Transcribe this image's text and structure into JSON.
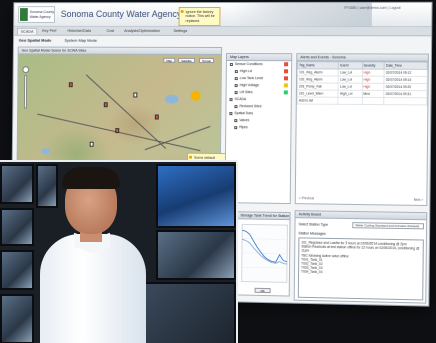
{
  "app": {
    "title": "Sonoma County Water Agency Pilot",
    "logo_text": "Sonoma County Water Agency",
    "user_info": "FF3380 | user@demo.com  | Logout"
  },
  "tabs": [
    "SCADA",
    "Key Perf",
    "Historian/Data",
    "Cost",
    "Analysis/Optimization",
    "Settings"
  ],
  "subtabs": [
    "Geo Spatial Mode",
    "System Map Mode"
  ],
  "notes": {
    "top": "Ignore the factory notice. This will be replaced.",
    "mid": "Some default selection, locations, status."
  },
  "map_panel": {
    "title": "Geo Spatial Model Scene for SCWA Sites",
    "buttons": [
      "Map",
      "Satellite",
      "Terrain"
    ]
  },
  "legend_panel": {
    "title": "Map Layers",
    "items": [
      {
        "label": "Sensor Conditions",
        "swatch": "#e74c3c"
      },
      {
        "label": "High Lvl",
        "swatch": "#e74c3c"
      },
      {
        "label": "Low Tank Level",
        "swatch": "#e74c3c"
      },
      {
        "label": "High Voltage",
        "swatch": "#f1c40f"
      },
      {
        "label": "Lift Sites",
        "swatch": "#2ecc71"
      },
      {
        "label": "SCADA",
        "swatch": ""
      },
      {
        "label": "Reduced Sites",
        "swatch": ""
      },
      {
        "label": "Spatial Data",
        "swatch": ""
      },
      {
        "label": "Valves",
        "swatch": ""
      },
      {
        "label": "Pipes",
        "swatch": ""
      }
    ]
  },
  "alerts_panel": {
    "title": "Alerts and Events - Sonoma",
    "columns": [
      "Tag_Name",
      "Event",
      "Severity",
      "Date_Time"
    ],
    "rows": [
      [
        "101_Reg_Alarm",
        "Low_Lvl",
        "High",
        "02/07/2014 09:12"
      ],
      [
        "102_Reg_Alarm",
        "Low_Lvl",
        "High",
        "02/07/2014 09:14"
      ],
      [
        "203_Pump_Fail",
        "Low_Lvl",
        "High",
        "02/07/2014 09:20"
      ],
      [
        "210_Level_Warn",
        "High_Lvl",
        "Med",
        "02/07/2014 09:31"
      ],
      [
        "Add to list",
        "",
        "",
        ""
      ]
    ],
    "footer_prev": "< Previous",
    "footer_next": "Next >"
  },
  "activity_panel": {
    "title": "Activity Board",
    "select_label": "Select Station Type",
    "select_value": "Water Cycling Standard and Animator (Default)",
    "messages_label": "Station Messages",
    "messages": [
      "101_Regulator and Lowflw for 3 hours at 02/06/2014 conditioning @ 2pm",
      "Station Readouts at test station offline for 12 hours on 02/06/2014, conditioning @ 11pm",
      "TBC following Active valve offline",
      "T001_Tank_01",
      "T002_Tank_02",
      "T003_Tank_03",
      "T004_Tank_04"
    ]
  },
  "chart_panel": {
    "title": "Storage Tank Trend for Station",
    "button": "OK"
  },
  "chart_data": {
    "type": "line",
    "title": "",
    "xlabel": "",
    "ylabel": "",
    "x": [
      0,
      1,
      2,
      3,
      4,
      5,
      6,
      7,
      8,
      9,
      10,
      11,
      12
    ],
    "series": [
      {
        "values": [
          9,
          8.8,
          8.3,
          7.2,
          6.1,
          5.2,
          4.4,
          3.9,
          3.6,
          3.5,
          4.8,
          3.8,
          3.6
        ]
      },
      {
        "values": [
          7.4,
          7.2,
          6.8,
          6.0,
          5.3,
          4.6,
          4.1,
          3.7,
          3.4,
          3.3,
          3.6,
          3.3,
          3.2
        ]
      }
    ],
    "ylim": [
      0,
      10
    ],
    "colors": [
      "#2f6fc4",
      "#7fa6d8"
    ]
  }
}
